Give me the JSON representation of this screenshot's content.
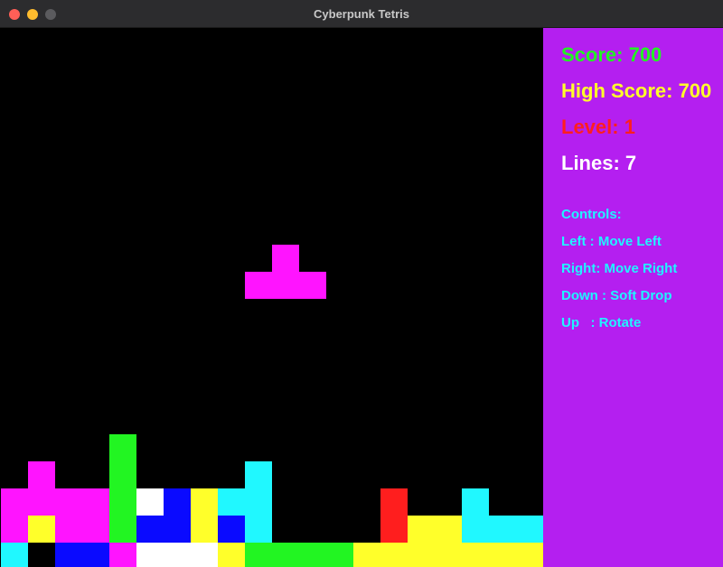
{
  "window": {
    "title": "Cyberpunk Tetris"
  },
  "colors": {
    "M": "#ff14ff",
    "G": "#22f522",
    "C": "#20f8ff",
    "W": "#ffffff",
    "B": "#0a0aff",
    "Y": "#ffff2a",
    "R": "#ff1e1e",
    "sidebar_bg": "#b41ff0"
  },
  "board": {
    "columns": 20,
    "rows": 20,
    "grid": [
      "....................",
      "....................",
      "....................",
      "....................",
      "....................",
      "....................",
      "....................",
      "....................",
      "....................",
      "....................",
      "....................",
      "....................",
      "....................",
      "....................",
      "....................",
      "....G...............",
      ".M..G....C..........",
      "MMMMGWBYCC....R..C..",
      "MYMMGBBYBC....RYYCCC",
      "C.BBMWWWYGGGGYYYYYYY"
    ],
    "active_piece": {
      "type": "T",
      "color_key": "M",
      "cells": [
        [
          10,
          8
        ],
        [
          9,
          9
        ],
        [
          10,
          9
        ],
        [
          11,
          9
        ]
      ]
    }
  },
  "stats": {
    "score": "Score: 700",
    "high_score": "High Score: 700",
    "level": "Level: 1",
    "lines": "Lines: 7",
    "score_color": "#22f522",
    "high_score_color": "#ffff2a",
    "level_color": "#ff1e1e",
    "lines_color": "#ffffff"
  },
  "controls": {
    "heading": "Controls:",
    "items": [
      "Left : Move Left",
      "Right: Move Right",
      "Down : Soft Drop",
      "Up   : Rotate"
    ]
  }
}
